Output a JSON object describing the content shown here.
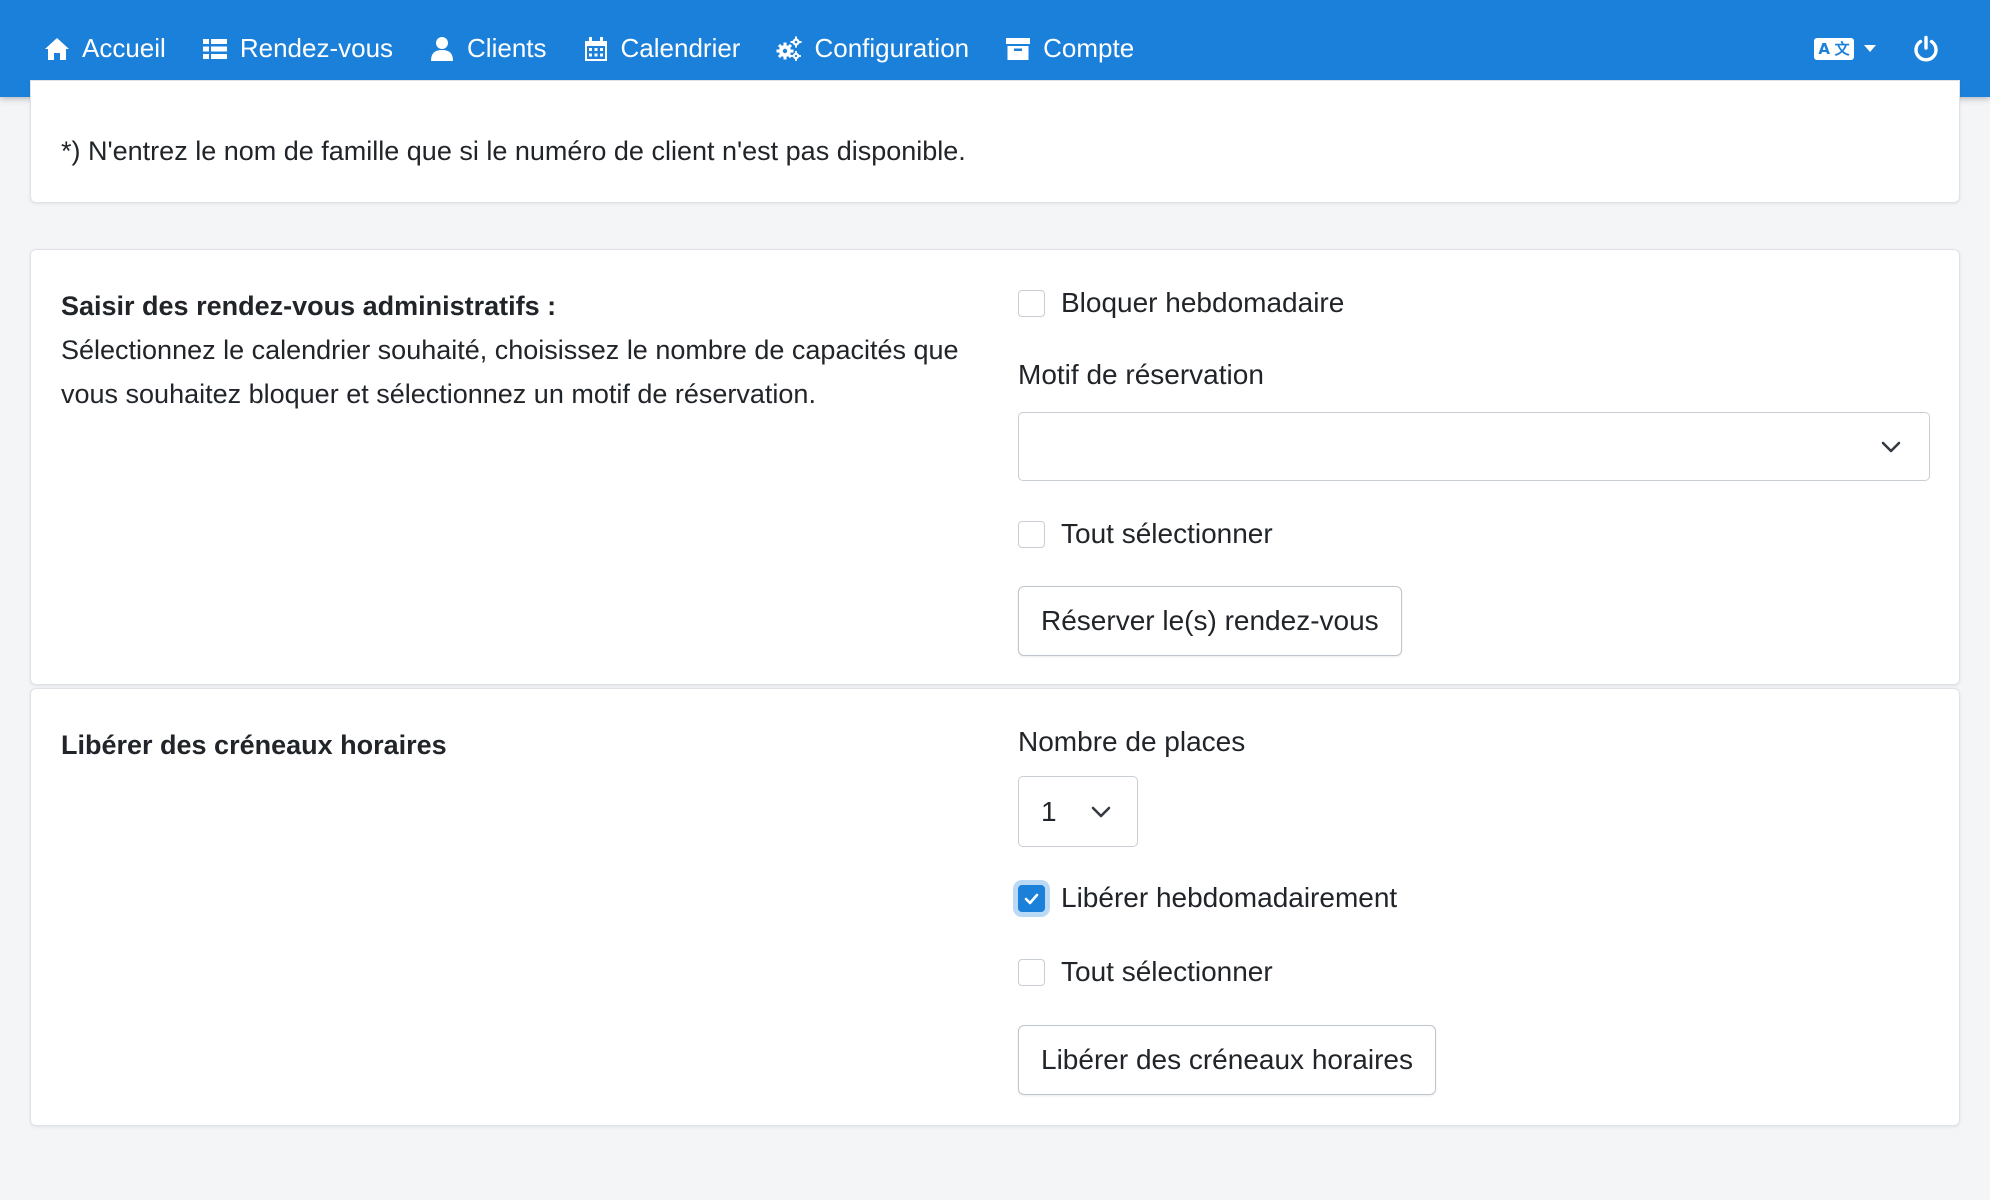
{
  "nav": {
    "items": [
      {
        "label": "Accueil",
        "icon": "home-icon"
      },
      {
        "label": "Rendez-vous",
        "icon": "list-icon"
      },
      {
        "label": "Clients",
        "icon": "user-icon"
      },
      {
        "label": "Calendrier",
        "icon": "calendar-icon"
      },
      {
        "label": "Configuration",
        "icon": "cogs-icon"
      },
      {
        "label": "Compte",
        "icon": "archive-icon"
      }
    ],
    "language_icon": "language-icon",
    "power_icon": "power-icon",
    "color": "#1b80d9"
  },
  "note": {
    "text": "*) N'entrez le nom de famille que si le numéro de client n'est pas disponible."
  },
  "admin_section": {
    "title": "Saisir des rendez-vous administratifs :",
    "description": "Sélectionnez le calendrier souhaité, choisissez le nombre de capacités que vous souhaitez bloquer et sélectionnez un motif de réservation.",
    "block_weekly": {
      "label": "Bloquer hebdomadaire",
      "checked": false
    },
    "reason_label": "Motif de réservation",
    "reason_value": "",
    "select_all": {
      "label": "Tout sélectionner",
      "checked": false
    },
    "submit_label": "Réserver le(s) rendez-vous"
  },
  "free_section": {
    "title": "Libérer des créneaux horaires",
    "places_label": "Nombre de places",
    "places_value": "1",
    "free_weekly": {
      "label": "Libérer hebdomadairement",
      "checked": true
    },
    "select_all": {
      "label": "Tout sélectionner",
      "checked": false
    },
    "submit_label": "Libérer des créneaux horaires"
  }
}
